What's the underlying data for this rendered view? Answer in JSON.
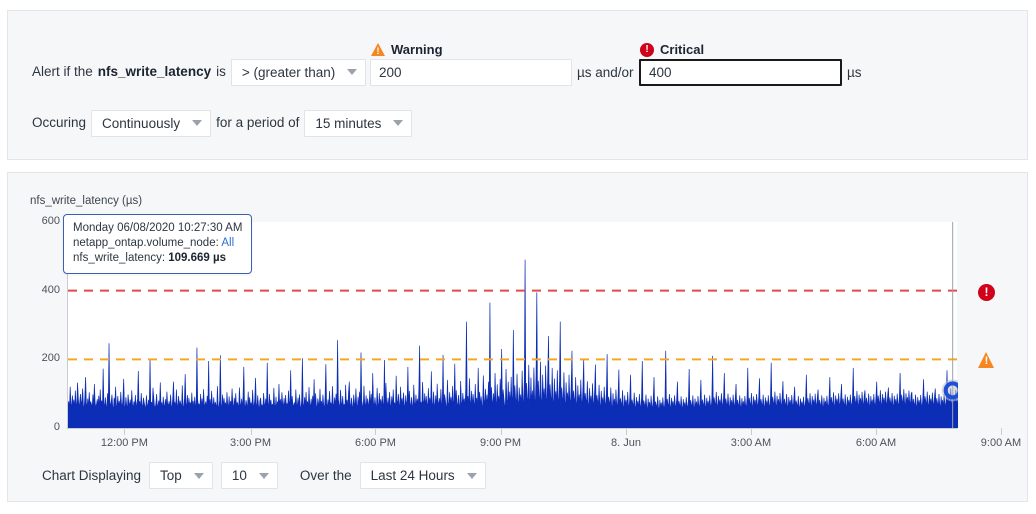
{
  "alert_panel": {
    "prefix_text": "Alert if the",
    "metric_name": "nfs_write_latency",
    "is_text": "is",
    "operator": "> (greater than)",
    "warning": {
      "label": "Warning",
      "icon": "warning-triangle-icon",
      "value": "200",
      "unit": "µs",
      "color": "#f6861f"
    },
    "and_or_text": "µs and/or",
    "critical": {
      "label": "Critical",
      "icon": "critical-circle-icon",
      "value": "400",
      "unit": "µs",
      "color": "#d0021b"
    },
    "occuring_label": "Occuring",
    "occurrence": "Continuously",
    "period_label": "for a period of",
    "period": "15 minutes"
  },
  "chart_panel": {
    "title": "nfs_write_latency (µs)",
    "tooltip": {
      "timestamp": "Monday 06/08/2020 10:27:30 AM",
      "node_label": "netapp_ontap.volume_node:",
      "node_value": "All",
      "metric_label": "nfs_write_latency:",
      "metric_value": "109.669 µs"
    },
    "controls": {
      "displaying_label": "Chart Displaying",
      "rank": "Top",
      "count": "10",
      "over_the_label": "Over the",
      "range": "Last 24 Hours"
    }
  },
  "chart_data": {
    "type": "area",
    "title": "nfs_write_latency (µs)",
    "xlabel": "",
    "ylabel": "nfs_write_latency (µs)",
    "ylim": [
      0,
      600
    ],
    "yticks": [
      0,
      200,
      400,
      600
    ],
    "xticks": [
      "12:00 PM",
      "3:00 PM",
      "6:00 PM",
      "9:00 PM",
      "8. Jun",
      "3:00 AM",
      "6:00 AM",
      "9:00 AM"
    ],
    "xtick_positions": [
      0.0645,
      0.2062,
      0.3466,
      0.4871,
      0.6281,
      0.7685,
      0.909,
      1.0494
    ],
    "grid": false,
    "legend": false,
    "series_color": "#0c2db6",
    "series_name": "nfs_write_latency",
    "thresholds": [
      {
        "name": "Warning",
        "value": 200,
        "color": "#f5a623",
        "style": "dashed"
      },
      {
        "name": "Critical",
        "value": 400,
        "color": "#e04a4a",
        "style": "dashed"
      }
    ],
    "hover_point": {
      "x_fraction": 0.994,
      "value": 109.669,
      "label": "109.669 µs"
    },
    "values": [
      62,
      78,
      55,
      120,
      71,
      58,
      95,
      64,
      83,
      52,
      109,
      70,
      60,
      132,
      88,
      57,
      74,
      99,
      63,
      81,
      115,
      66,
      54,
      91,
      148,
      73,
      60,
      86,
      59,
      104,
      67,
      77,
      69,
      56,
      98,
      62,
      128,
      75,
      58,
      70,
      84,
      61,
      94,
      53,
      112,
      66,
      80,
      57,
      173,
      72,
      60,
      89,
      65,
      55,
      101,
      68,
      247,
      82,
      59,
      76,
      97,
      63,
      54,
      88,
      70,
      120,
      58,
      66,
      93,
      61,
      79,
      56,
      105,
      71,
      60,
      85,
      143,
      64,
      57,
      90,
      68,
      52,
      98,
      75,
      62,
      83,
      55,
      110,
      69,
      58,
      77,
      64,
      96,
      53,
      72,
      85,
      166,
      60,
      78,
      56,
      102,
      67,
      59,
      88,
      74,
      63,
      51,
      95,
      70,
      57,
      82,
      66,
      200,
      61,
      76,
      54,
      117,
      89,
      64,
      58,
      72,
      99,
      55,
      68,
      80,
      62,
      133,
      59,
      75,
      53,
      91,
      67,
      60,
      84,
      56,
      106,
      71,
      63,
      78,
      52,
      97,
      65,
      58,
      87,
      135,
      69,
      74,
      55,
      112,
      61,
      66,
      93,
      57,
      80,
      70,
      51,
      124,
      64,
      59,
      85,
      157,
      72,
      60,
      96,
      54,
      88,
      68,
      75,
      56,
      103,
      62,
      79,
      53,
      91,
      67,
      58,
      234,
      82,
      65,
      71,
      55,
      99,
      60,
      86,
      52,
      113,
      70,
      63,
      77,
      57,
      94,
      66,
      195,
      59,
      84,
      54,
      108,
      72,
      61,
      89,
      56,
      76,
      68,
      51,
      122,
      64,
      58,
      81,
      212,
      70,
      55,
      97,
      62,
      87,
      66,
      74,
      53,
      104,
      69,
      60,
      92,
      57,
      79,
      65,
      115,
      71,
      54,
      88,
      63,
      101,
      59,
      76,
      68,
      52,
      118,
      73,
      61,
      85,
      56,
      94,
      178,
      67,
      58,
      81,
      70,
      53,
      106,
      64,
      90,
      60,
      75,
      55,
      111,
      69,
      62,
      83,
      146,
      72,
      57,
      95,
      66,
      51,
      79,
      88,
      60,
      68,
      54,
      102,
      71,
      63,
      86,
      58,
      190,
      74,
      56,
      99,
      65,
      82,
      61,
      70,
      53,
      117,
      67,
      59,
      91,
      55,
      77,
      69,
      128,
      62,
      84,
      57,
      104,
      73,
      60,
      87,
      52,
      96,
      66,
      71,
      58,
      109,
      64,
      80,
      168,
      56,
      93,
      68,
      61,
      75,
      54,
      112,
      70,
      63,
      88,
      59,
      98,
      66,
      51,
      82,
      203,
      72,
      57,
      90,
      65,
      105,
      60,
      78,
      53,
      119,
      69,
      62,
      85,
      56,
      94,
      71,
      142,
      58,
      101,
      67,
      54,
      86,
      73,
      60,
      114,
      64,
      79,
      55,
      97,
      68,
      52,
      91,
      186,
      70,
      61,
      83,
      57,
      108,
      66,
      74,
      53,
      122,
      72,
      59,
      89,
      63,
      100,
      56,
      256,
      85,
      68,
      54,
      111,
      77,
      60,
      93,
      58,
      70,
      51,
      126,
      65,
      82,
      57,
      103,
      135,
      71,
      59,
      88,
      66,
      53,
      97,
      74,
      61,
      115,
      69,
      55,
      91,
      63,
      106,
      58,
      220,
      80,
      67,
      52,
      123,
      72,
      60,
      95,
      56,
      86,
      70,
      64,
      109,
      57,
      99,
      54,
      160,
      75,
      62,
      89,
      68,
      51,
      117,
      73,
      59,
      102,
      66,
      84,
      55,
      94,
      70,
      61,
      198,
      57,
      131,
      76,
      63,
      88,
      53,
      105,
      69,
      60,
      92,
      58,
      112,
      67,
      74,
      52,
      152,
      81,
      65,
      99,
      71,
      56,
      120,
      64,
      87,
      59,
      103,
      70,
      54,
      95,
      66,
      78,
      178,
      62,
      108,
      73,
      57,
      90,
      68,
      51,
      126,
      75,
      61,
      97,
      65,
      85,
      58,
      111,
      240,
      69,
      76,
      54,
      134,
      82,
      63,
      101,
      56,
      93,
      71,
      60,
      116,
      67,
      88,
      52,
      165,
      74,
      58,
      106,
      70,
      62,
      95,
      55,
      129,
      79,
      64,
      87,
      59,
      113,
      68,
      72,
      213,
      57,
      98,
      84,
      66,
      53,
      140,
      75,
      61,
      104,
      70,
      90,
      56,
      122,
      65,
      81,
      187,
      60,
      110,
      72,
      58,
      96,
      68,
      54,
      137,
      77,
      63,
      102,
      71,
      86,
      55,
      118,
      310,
      67,
      93,
      59,
      145,
      80,
      64,
      108,
      57,
      99,
      73,
      61,
      128,
      69,
      88,
      53,
      175,
      76,
      105,
      62,
      92,
      66,
      58,
      153,
      82,
      70,
      114,
      60,
      97,
      55,
      135,
      72,
      365,
      68,
      119,
      84,
      63,
      101,
      57,
      160,
      78,
      66,
      127,
      71,
      94,
      59,
      143,
      75,
      230,
      61,
      112,
      88,
      67,
      54,
      172,
      83,
      70,
      135,
      64,
      106,
      58,
      149,
      77,
      92,
      285,
      69,
      124,
      86,
      62,
      158,
      79,
      65,
      118,
      73,
      98,
      56,
      167,
      81,
      71,
      140,
      490,
      67,
      131,
      90,
      63,
      184,
      85,
      72,
      147,
      68,
      109,
      59,
      176,
      83,
      74,
      152,
      395,
      70,
      138,
      94,
      66,
      193,
      87,
      61,
      155,
      76,
      115,
      57,
      182,
      88,
      73,
      161,
      268,
      64,
      127,
      92,
      69,
      175,
      84,
      58,
      144,
      79,
      107,
      62,
      168,
      86,
      71,
      138,
      310,
      66,
      118,
      89,
      74,
      162,
      81,
      55,
      133,
      77,
      103,
      60,
      155,
      83,
      68,
      126,
      225,
      63,
      109,
      86,
      71,
      148,
      78,
      57,
      124,
      72,
      98,
      59,
      141,
      80,
      65,
      117,
      200,
      61,
      102,
      83,
      68,
      136,
      75,
      54,
      116,
      70,
      94,
      57,
      130,
      77,
      63,
      110,
      185,
      59,
      96,
      80,
      66,
      126,
      73,
      52,
      108,
      68,
      89,
      55,
      120,
      74,
      61,
      103,
      215,
      57,
      91,
      77,
      64,
      118,
      70,
      51,
      101,
      66,
      85,
      53,
      112,
      71,
      59,
      97,
      170,
      55,
      87,
      74,
      62,
      110,
      68,
      50,
      95,
      64,
      82,
      52,
      105,
      69,
      57,
      92,
      155,
      54,
      83,
      71,
      60,
      103,
      66,
      49,
      90,
      62,
      79,
      51,
      99,
      67,
      56,
      88,
      195,
      53,
      80,
      69,
      58,
      97,
      64,
      48,
      86,
      60,
      76,
      50,
      94,
      65,
      55,
      84,
      148,
      52,
      77,
      67,
      57,
      92,
      62,
      47,
      82,
      59,
      74,
      49,
      89,
      63,
      54,
      81,
      225,
      56,
      85,
      70,
      60,
      99,
      66,
      51,
      88,
      62,
      78,
      52,
      95,
      68,
      57,
      86,
      135,
      55,
      79,
      68,
      58,
      92,
      64,
      50,
      84,
      60,
      75,
      51,
      90,
      66,
      56,
      82,
      172,
      54,
      81,
      69,
      59,
      95,
      65,
      52,
      86,
      61,
      77,
      53,
      93,
      67,
      57,
      84,
      140,
      56,
      83,
      71,
      61,
      97,
      67,
      53,
      88,
      63,
      79,
      54,
      95,
      69,
      58,
      86,
      210,
      58,
      89,
      74,
      63,
      105,
      70,
      55,
      93,
      66,
      83,
      56,
      101,
      72,
      60,
      90,
      160,
      57,
      86,
      72,
      62,
      100,
      68,
      54,
      90,
      64,
      81,
      55,
      97,
      70,
      59,
      88,
      128,
      55,
      82,
      70,
      60,
      95,
      66,
      52,
      87,
      62,
      78,
      54,
      93,
      68,
      57,
      85,
      175,
      58,
      88,
      73,
      63,
      102,
      69,
      55,
      92,
      65,
      82,
      56,
      99,
      71,
      60,
      89,
      145,
      56,
      84,
      71,
      61,
      97,
      67,
      53,
      89,
      63,
      80,
      55,
      95,
      69,
      58,
      87,
      190,
      59,
      91,
      75,
      64,
      106,
      71,
      56,
      94,
      67,
      84,
      57,
      102,
      73,
      61,
      91,
      136,
      57,
      85,
      72,
      62,
      99,
      68,
      54,
      90,
      64,
      81,
      56,
      96,
      70,
      59,
      88,
      120,
      55,
      80,
      69,
      59,
      93,
      65,
      52,
      86,
      62,
      77,
      53,
      91,
      67,
      57,
      84,
      155,
      58,
      87,
      73,
      63,
      101,
      70,
      55,
      93,
      66,
      83,
      57,
      100,
      72,
      61,
      90,
      112,
      56,
      82,
      70,
      60,
      95,
      67,
      53,
      88,
      63,
      79,
      55,
      94,
      69,
      58,
      86,
      148,
      59,
      90,
      75,
      64,
      104,
      71,
      56,
      95,
      68,
      85,
      58,
      101,
      73,
      62,
      92,
      128,
      57,
      86,
      72,
      62,
      98,
      68,
      54,
      91,
      65,
      82,
      56,
      97,
      71,
      60,
      88,
      175,
      60,
      93,
      77,
      66,
      108,
      73,
      57,
      97,
      69,
      87,
      59,
      105,
      75,
      63,
      94,
      110,
      58,
      88,
      74,
      63,
      100,
      70,
      55,
      93,
      66,
      83,
      57,
      99,
      72,
      61,
      90,
      135,
      61,
      95,
      78,
      67,
      110,
      74,
      58,
      99,
      70,
      88,
      60,
      106,
      76,
      64,
      96,
      118,
      59,
      89,
      75,
      64,
      102,
      71,
      56,
      94,
      67,
      84,
      58,
      100,
      73,
      62,
      91,
      160,
      62,
      97,
      80,
      68,
      113,
      76,
      59,
      101,
      72,
      90,
      61,
      109,
      78,
      65,
      98,
      105,
      57,
      85,
      72,
      61,
      97,
      68,
      54,
      90,
      65,
      81,
      56,
      96,
      70,
      59,
      87,
      142,
      60,
      92,
      77,
      65,
      106,
      72,
      57,
      96,
      68,
      86,
      58,
      103,
      74,
      63,
      93,
      115,
      58,
      87,
      73,
      62,
      99,
      69,
      55,
      92,
      66,
      82,
      57,
      98,
      71,
      60,
      89,
      168,
      63,
      99,
      81,
      69,
      115,
      77,
      60,
      103,
      73,
      92,
      62,
      111,
      79,
      66,
      100
    ]
  }
}
